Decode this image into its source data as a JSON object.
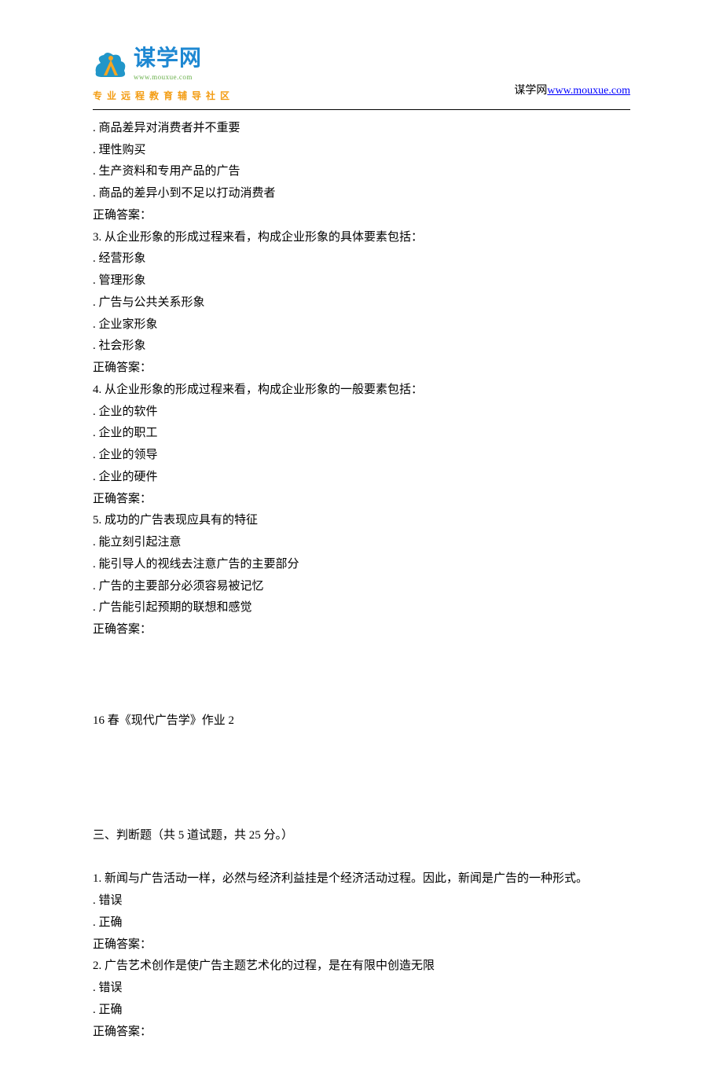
{
  "header": {
    "logo_main": "谋学网",
    "logo_sub_url": "www.mouxue.com",
    "tagline": "专业远程教育辅导社区",
    "site_label": "谋学网",
    "site_url_text": "www.mouxue.com",
    "site_url_href": "http://www.mouxue.com"
  },
  "content": {
    "top_options": [
      "商品差异对消费者并不重要",
      "理性购买",
      "生产资料和专用产品的广告",
      "商品的差异小到不足以打动消费者"
    ],
    "correct_label": "正确答案：",
    "q3": {
      "stem": "3.   从企业形象的形成过程来看，构成企业形象的具体要素包括：",
      "options": [
        "经营形象",
        "管理形象",
        "广告与公共关系形象",
        "企业家形象",
        "社会形象"
      ]
    },
    "q4": {
      "stem": "4.   从企业形象的形成过程来看，构成企业形象的一般要素包括：",
      "options": [
        "企业的软件",
        "企业的职工",
        "企业的领导",
        "企业的硬件"
      ]
    },
    "q5": {
      "stem": "5.   成功的广告表现应具有的特征",
      "options": [
        "能立刻引起注意",
        "能引导人的视线去注意广告的主要部分",
        "广告的主要部分必须容易被记忆",
        "广告能引起预期的联想和感觉"
      ]
    },
    "title2": "16 春《现代广告学》作业 2",
    "section3_header": "三、判断题（共 5 道试题，共 25 分。）",
    "tq1": {
      "stem": "1.   新闻与广告活动一样，必然与经济利益挂是个经济活动过程。因此，新闻是广告的一种形式。",
      "options": [
        "错误",
        "正确"
      ]
    },
    "tq2": {
      "stem": "2.   广告艺术创作是使广告主题艺术化的过程，是在有限中创造无限",
      "options": [
        "错误",
        "正确"
      ]
    }
  }
}
